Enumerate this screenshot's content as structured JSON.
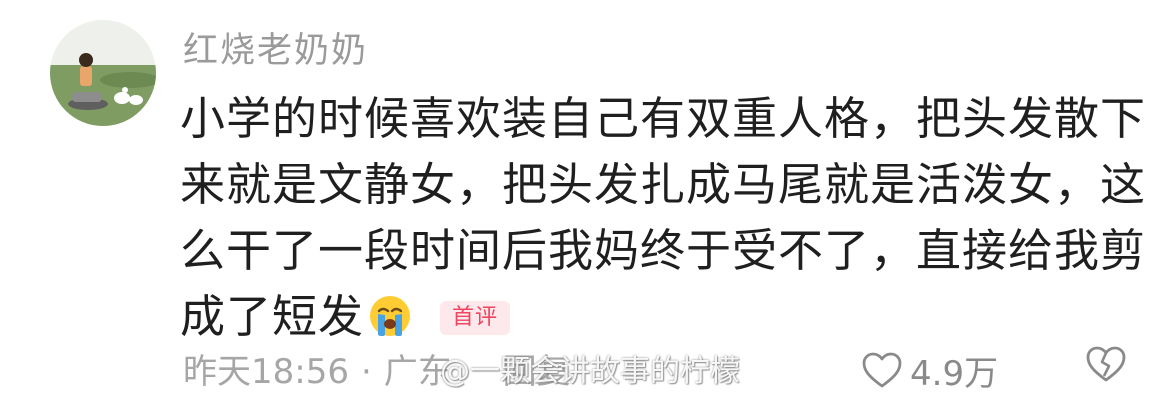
{
  "comment": {
    "username": "红烧老奶奶",
    "lines": [
      "小学的时候喜欢装自己有双重人格，把头发散下",
      "来就是文静女，把头发扎成马尾就是活泼女，这",
      "么干了一段时间后我妈终于受不了，直接给我剪",
      "成了短发"
    ],
    "emoji": "crying-face",
    "badge": "首评",
    "time": "昨天18:56",
    "separator": "·",
    "location": "广东",
    "reply_label": "回复",
    "like_count": "4.9万"
  },
  "watermark": "@一颗会讲故事的柠檬",
  "colors": {
    "badge_bg": "#fde8ec",
    "badge_text": "#f0455f",
    "meta_gray": "#a6a6a6"
  }
}
